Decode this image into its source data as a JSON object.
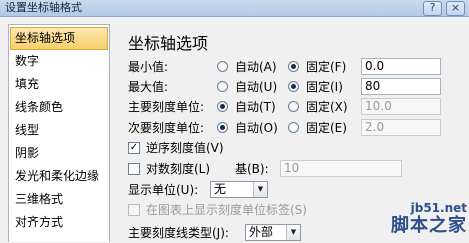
{
  "window": {
    "title": "设置坐标轴格式",
    "help_icon": "?",
    "close_icon": "×"
  },
  "sidebar": {
    "items": [
      {
        "label": "坐标轴选项",
        "active": true
      },
      {
        "label": "数字"
      },
      {
        "label": "填充"
      },
      {
        "label": "线条颜色"
      },
      {
        "label": "线型"
      },
      {
        "label": "阴影"
      },
      {
        "label": "发光和柔化边缘"
      },
      {
        "label": "三维格式"
      },
      {
        "label": "对齐方式"
      }
    ]
  },
  "main": {
    "title": "坐标轴选项",
    "min": {
      "label": "最小值:",
      "auto": "自动(A)",
      "fixed": "固定(F)",
      "value": "0.0",
      "selected": "fixed"
    },
    "max": {
      "label": "最大值:",
      "auto": "自动(U)",
      "fixed": "固定(I)",
      "value": "80",
      "selected": "fixed"
    },
    "major_unit": {
      "label": "主要刻度单位:",
      "auto": "自动(T)",
      "fixed": "固定(X)",
      "value": "10.0",
      "selected": "auto"
    },
    "minor_unit": {
      "label": "次要刻度单位:",
      "auto": "自动(O)",
      "fixed": "固定(E)",
      "value": "2.0",
      "selected": "auto"
    },
    "reverse": {
      "label": "逆序刻度值(V)",
      "checked": true,
      "check_mark": "✓"
    },
    "log_scale": {
      "label": "对数刻度(L)",
      "base_label": "基(B):",
      "base_value": "10",
      "checked": false
    },
    "display_units": {
      "label": "显示单位(U):",
      "value": "无",
      "arrow": "▼"
    },
    "show_units_label": {
      "label": "在图表上显示刻度单位标签(S)",
      "checked": false
    },
    "major_tick_type": {
      "label": "主要刻度线类型(J):",
      "value": "外部",
      "arrow": "▼"
    }
  },
  "watermark": {
    "url": "jb51.net",
    "text": "脚本之家"
  }
}
